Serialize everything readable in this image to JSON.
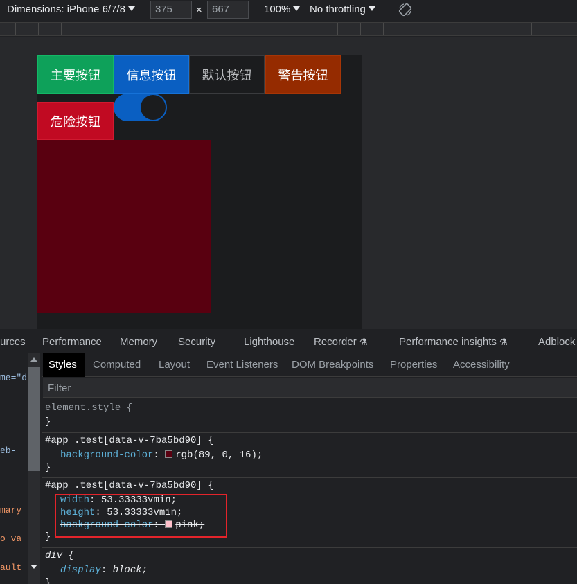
{
  "toolbar": {
    "dimensions_label": "Dimensions: iPhone 6/7/8",
    "width_value": "375",
    "times": "×",
    "height_value": "667",
    "zoom": "100%",
    "throttling": "No throttling",
    "rotate_icon": "rotate-icon"
  },
  "page": {
    "buttons": {
      "primary": "主要按钮",
      "info": "信息按钮",
      "default": "默认按钮",
      "warning": "警告按钮",
      "danger": "危险按钮"
    },
    "switch_on": true,
    "colors": {
      "primary": "#0ea15a",
      "info": "#0a5fc2",
      "warning": "#952b00",
      "danger": "#c10a22",
      "test_box": "#590010"
    }
  },
  "devtools": {
    "panel_tabs": [
      "urces",
      "Performance",
      "Memory",
      "Security",
      "Lighthouse",
      "Recorder",
      "Performance insights",
      "Adblock"
    ],
    "elements_fragments": [
      "me=\"d",
      "eb-",
      "mary",
      "o va",
      "ault"
    ],
    "sidebar_tabs": {
      "active": "Styles",
      "others": [
        "Computed",
        "Layout",
        "Event Listeners",
        "DOM Breakpoints",
        "Properties",
        "Accessibility"
      ]
    },
    "filter_placeholder": "Filter",
    "rules": {
      "element_style": "element.style {",
      "rule1_selector": "#app .test[data-v-7ba5bd90] {",
      "rule1_prop": "background-color",
      "rule1_value": "rgb(89, 0, 16);",
      "rule2_selector": "#app .test[data-v-7ba5bd90] {",
      "rule2_width_prop": "width",
      "rule2_width_val": "53.33333vmin;",
      "rule2_height_prop": "height",
      "rule2_height_val": "53.33333vmin;",
      "rule2_bg_prop": "background-color",
      "rule2_bg_val": "pink;",
      "div_selector": "div {",
      "div_prop": "display",
      "div_val": "block;",
      "close_brace": "}"
    }
  }
}
